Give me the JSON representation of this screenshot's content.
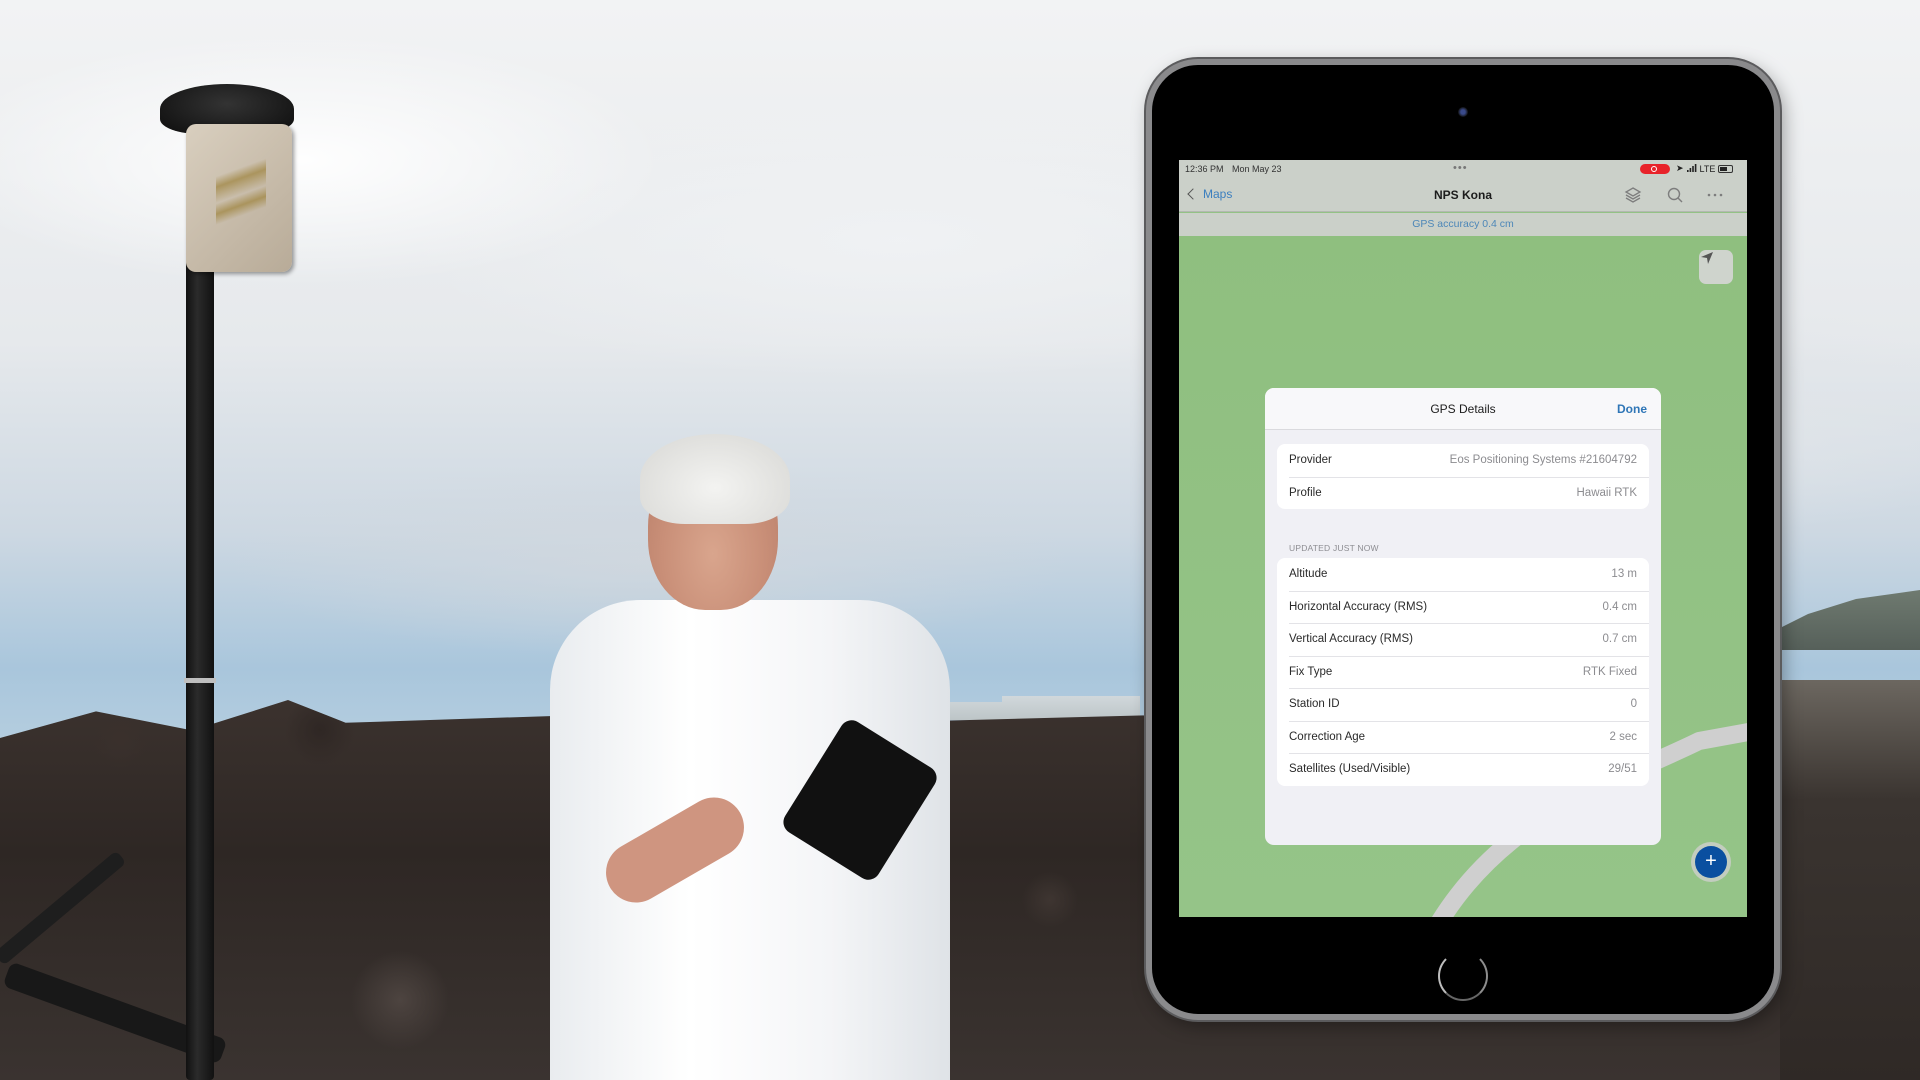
{
  "status_bar": {
    "time": "12:36 PM",
    "date": "Mon May 23",
    "network": "LTE",
    "indicators": [
      "screen-record-icon",
      "location-arrow-icon",
      "signal-bars-icon",
      "battery-icon"
    ]
  },
  "nav": {
    "back_label": "Maps",
    "title": "NPS Kona",
    "icons": [
      "layers-icon",
      "search-icon",
      "more-icon"
    ]
  },
  "accuracy_banner": "GPS accuracy 0.4 cm",
  "map": {
    "buttons": [
      "locate-icon",
      "add-icon"
    ],
    "add_label": "+"
  },
  "gps_details": {
    "title": "GPS Details",
    "done_label": "Done",
    "device_rows": [
      {
        "label": "Provider",
        "value": "Eos Positioning Systems #21604792"
      },
      {
        "label": "Profile",
        "value": "Hawaii RTK"
      }
    ],
    "section_header": "UPDATED JUST NOW",
    "reading_rows": [
      {
        "label": "Altitude",
        "value": "13 m"
      },
      {
        "label": "Horizontal Accuracy (RMS)",
        "value": "0.4 cm"
      },
      {
        "label": "Vertical Accuracy (RMS)",
        "value": "0.7 cm"
      },
      {
        "label": "Fix Type",
        "value": "RTK Fixed"
      },
      {
        "label": "Station ID",
        "value": "0"
      },
      {
        "label": "Correction Age",
        "value": "2 sec"
      },
      {
        "label": "Satellites (Used/Visible)",
        "value": "29/51"
      }
    ]
  },
  "colors": {
    "accent": "#2f76b7",
    "map_green": "#93c285",
    "add_button": "#0a4fa0",
    "record_red": "#e8232a"
  }
}
